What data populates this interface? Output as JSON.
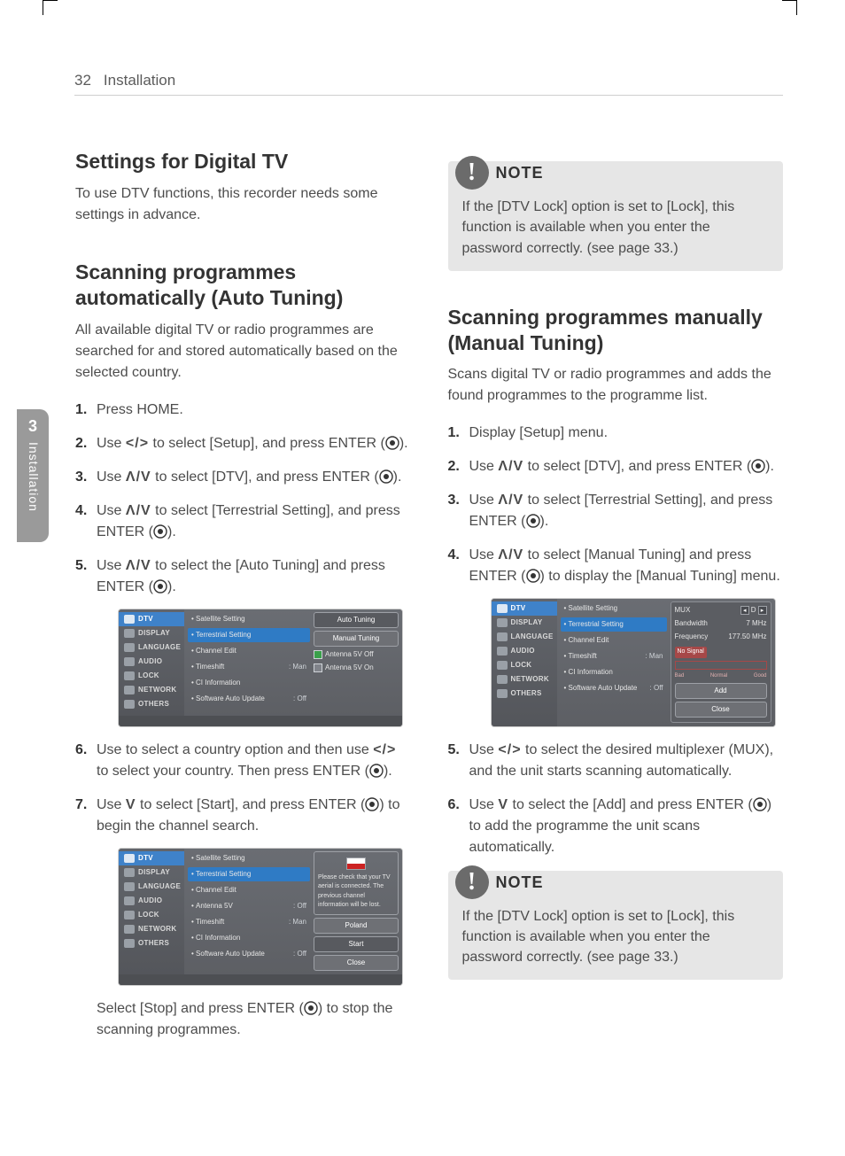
{
  "header": {
    "page_number": "32",
    "section": "Installation"
  },
  "side_tab": {
    "chapter": "3",
    "label": "Installation"
  },
  "left": {
    "h_settings": "Settings for Digital TV",
    "p_settings": "To use DTV functions, this recorder needs some settings in advance.",
    "h_auto": "Scanning programmes automatically (Auto Tuning)",
    "p_auto": "All available digital TV or radio programmes are searched for and stored automatically based on the selected country.",
    "steps_auto": {
      "s1": "Press HOME.",
      "s2a": "Use ",
      "s2b": " to select [Setup], and press ENTER (",
      "s2c": ").",
      "s3a": "Use ",
      "s3b": " to select [DTV], and press ENTER (",
      "s3c": ").",
      "s4a": "Use ",
      "s4b": " to select [Terrestrial Setting], and press ENTER (",
      "s4c": ").",
      "s5a": "Use ",
      "s5b": " to select the [Auto Tuning] and press ENTER (",
      "s5c": ").",
      "s6a": "Use to select a country option and then use ",
      "s6b": " to select your country. Then press ENTER (",
      "s6c": ").",
      "s7a": "Use ",
      "s7b": " to select [Start], and press ENTER (",
      "s7c": ") to begin the channel search."
    },
    "after7a": "Select [Stop] and press ENTER (",
    "after7b": ") to stop the scanning programmes."
  },
  "right": {
    "note1": "If the [DTV Lock] option is set to [Lock], this function is available when you enter the password correctly. (see page 33.)",
    "h_manual": "Scanning programmes manually (Manual Tuning)",
    "p_manual": "Scans digital TV or radio programmes and adds the found programmes to the programme list.",
    "steps_manual": {
      "s1": "Display [Setup] menu.",
      "s2a": "Use ",
      "s2b": " to select [DTV], and press ENTER (",
      "s2c": ").",
      "s3a": "Use ",
      "s3b": " to select [Terrestrial Setting], and press ENTER (",
      "s3c": ").",
      "s4a": "Use ",
      "s4b": " to select [Manual Tuning] and press ENTER (",
      "s4c": ") to display the [Manual Tuning] menu.",
      "s5a": "Use ",
      "s5b": " to select the desired multiplexer (MUX), and the unit starts scanning automatically.",
      "s6a": "Use ",
      "s6b": " to select the [Add] and press ENTER (",
      "s6c": ") to add the programme the unit scans automatically."
    },
    "note2": "If the [DTV Lock] option is set to [Lock], this function is available when you enter the password correctly. (see page 33.)"
  },
  "glyphs": {
    "lr": "</>",
    "ud": "U/u",
    "down": "u"
  },
  "note_label": "NOTE",
  "shot_common": {
    "side": [
      "DTV",
      "DISPLAY",
      "LANGUAGE",
      "AUDIO",
      "LOCK",
      "NETWORK",
      "OTHERS"
    ],
    "opts_full": [
      {
        "l": "Satellite Setting",
        "v": ""
      },
      {
        "l": "Terrestrial Setting",
        "v": "",
        "hl": true
      },
      {
        "l": "Channel Edit",
        "v": ""
      },
      {
        "l": "Timeshift",
        "v": ": Man"
      },
      {
        "l": "CI Information",
        "v": ""
      },
      {
        "l": "Software Auto Update",
        "v": ": Off"
      }
    ],
    "opts_b": [
      {
        "l": "Satellite Setting",
        "v": ""
      },
      {
        "l": "Terrestrial Setting",
        "v": "",
        "hl": true
      },
      {
        "l": "Channel Edit",
        "v": ""
      },
      {
        "l": "Antenna 5V",
        "v": ": Off"
      },
      {
        "l": "Timeshift",
        "v": ": Man"
      },
      {
        "l": "CI Information",
        "v": ""
      },
      {
        "l": "Software Auto Update",
        "v": ": Off"
      }
    ]
  },
  "shotA": {
    "buttons": [
      "Auto Tuning",
      "Manual Tuning"
    ],
    "checks": [
      {
        "l": "Antenna 5V Off",
        "on": true
      },
      {
        "l": "Antenna 5V On",
        "on": false
      }
    ]
  },
  "shotB": {
    "msg": "Please check that your TV aerial is connected. The previous channel information will be lost.",
    "country": "Poland",
    "start": "Start",
    "close": "Close"
  },
  "shotC": {
    "mux_label": "MUX",
    "mux_value": "D",
    "bw_label": "Bandwidth",
    "bw_value": "7 MHz",
    "freq_label": "Frequency",
    "freq_value": "177.50 MHz",
    "nosig": "No Signal",
    "bad": "Bad",
    "normal": "Normal",
    "good": "Good",
    "add": "Add",
    "close": "Close"
  }
}
